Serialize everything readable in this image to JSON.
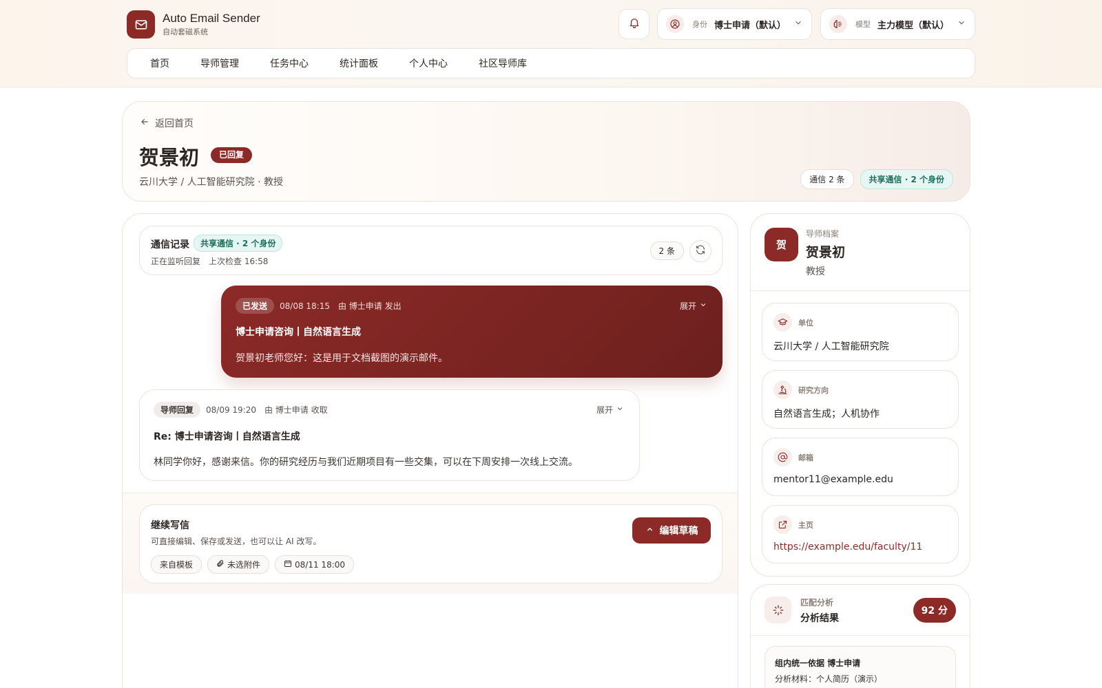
{
  "app": {
    "title": "Auto Email Sender",
    "subtitle": "自动套磁系统"
  },
  "selectors": {
    "identity": {
      "label": "身份",
      "value": "博士申请（默认）"
    },
    "model": {
      "label": "模型",
      "value": "主力模型（默认）"
    }
  },
  "nav": {
    "items": [
      {
        "label": "首页"
      },
      {
        "label": "导师管理"
      },
      {
        "label": "任务中心"
      },
      {
        "label": "统计面板"
      },
      {
        "label": "个人中心"
      },
      {
        "label": "社区导师库"
      }
    ]
  },
  "hero": {
    "back_label": "返回首页",
    "name": "贺景初",
    "status": "已回复",
    "subtitle": "云川大学 / 人工智能研究院 · 教授",
    "chips": {
      "count": "通信 2 条",
      "shared": "共享通信 · 2 个身份"
    }
  },
  "communication": {
    "title": "通信记录",
    "shared_tag": "共享通信 · 2 个身份",
    "status": "正在监听回复　上次检查 16:58",
    "count": "2 条",
    "messages": [
      {
        "tag": "已发送",
        "meta": "08/08 18:15　由 博士申请 发出",
        "expand": "展开",
        "subject": "博士申请咨询丨自然语言生成",
        "body": "贺景初老师您好：这是用于文档截图的演示邮件。"
      },
      {
        "tag": "导师回复",
        "meta": "08/09 19:20　由 博士申请 收取",
        "expand": "展开",
        "subject": "Re: 博士申请咨询丨自然语言生成",
        "body": "林同学你好，感谢来信。你的研究经历与我们近期项目有一些交集，可以在下周安排一次线上交流。"
      }
    ]
  },
  "compose": {
    "title": "继续写信",
    "description": "可直接编辑、保存或发送，也可以让 AI 改写。",
    "edit_button": "编辑草稿",
    "chips": {
      "template": "来自模板",
      "attachment": "未选附件",
      "schedule": "08/11 18:00"
    }
  },
  "profile": {
    "kicker": "导师档案",
    "avatar": "贺",
    "name": "贺景初",
    "title": "教授",
    "fields": {
      "unit": {
        "label": "单位",
        "value": "云川大学 / 人工智能研究院"
      },
      "research": {
        "label": "研究方向",
        "value": "自然语言生成；人机协作"
      },
      "email": {
        "label": "邮箱",
        "value": "mentor11@example.edu"
      },
      "homepage": {
        "label": "主页",
        "value": "https://example.edu/faculty/11"
      }
    }
  },
  "match": {
    "kicker": "匹配分析",
    "title": "分析结果",
    "score": "92 分",
    "basis": "组内统一依据 博士申请",
    "material": "分析材料：个人简历（演示）"
  },
  "colors": {
    "accent": "#8c2a27",
    "teal": "#1f6e5f"
  }
}
